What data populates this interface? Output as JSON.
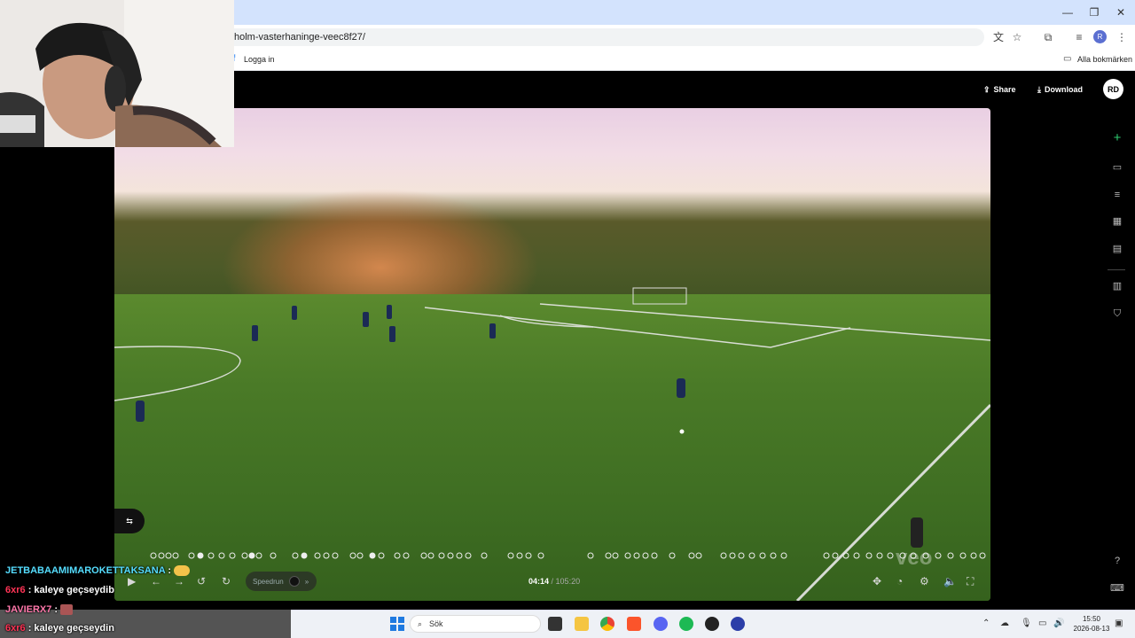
{
  "browser": {
    "url": "holm-vasterhaninge-veec8f27/",
    "bookmark_login": "Logga in",
    "bookmarks_all": "Alla bokmärken",
    "profile_initial": "R"
  },
  "header": {
    "share": "Share",
    "download": "Download",
    "avatar": "RD"
  },
  "player": {
    "speedrun_label": "Speedrun",
    "time_current": "04:14",
    "time_total": "/ 105:20",
    "watermark": "veo"
  },
  "chat": [
    {
      "user": "JETBABAAMIMAROKETTAKSANA",
      "sep": " : ",
      "msg": "",
      "color": "#55ddff"
    },
    {
      "user": "6xr6",
      "sep": " : ",
      "msg": "kaleye geçseydib",
      "color": "#ff3355"
    },
    {
      "user": "JAVIERX7",
      "sep": " : ",
      "msg": "",
      "color": "#ff77aa"
    },
    {
      "user": "6xr6",
      "sep": " : ",
      "msg": "kaleye geçseydin",
      "color": "#ff3355"
    }
  ],
  "taskbar": {
    "search_placeholder": "Sök",
    "time": "15:50",
    "date": "2026-08-13"
  },
  "colors": {
    "accent_green": "#2ecc71",
    "app_bg": "#000000",
    "chrome_titlebar": "#d3e3fd"
  },
  "icons": [
    "translate-icon",
    "star-icon",
    "extensions-icon",
    "media-icon",
    "menu-icon",
    "share-icon",
    "download-icon",
    "plus-icon",
    "camera-icon",
    "list-icon",
    "scoreboard-icon",
    "document-icon",
    "stats-icon",
    "jersey-icon",
    "help-icon",
    "keyboard-icon"
  ]
}
